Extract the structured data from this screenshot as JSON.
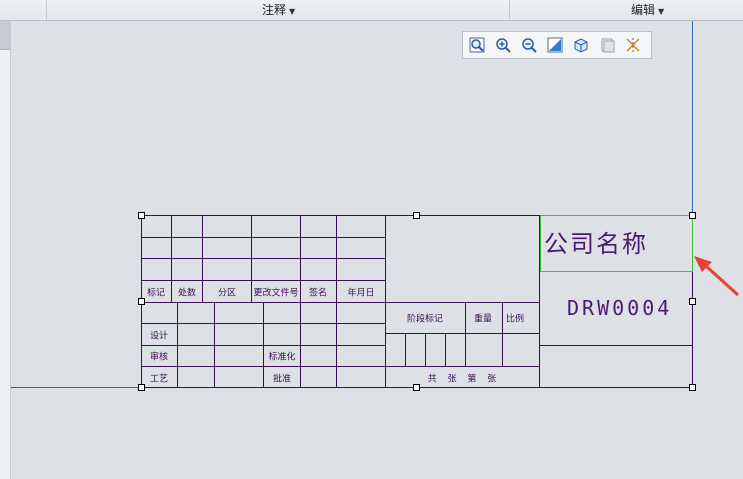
{
  "ribbon": {
    "annotate_label": "注释",
    "edit_label": "编辑"
  },
  "toolbar": {
    "icons": [
      "zoom-window-icon",
      "zoom-in-icon",
      "zoom-out-icon",
      "repaint-icon",
      "view-cube-icon",
      "saved-views-icon",
      "display-style-icon"
    ]
  },
  "title_block": {
    "company_name": "公司名称",
    "drawing_number": "DRW0004",
    "rev_header": [
      "标记",
      "处数",
      "分区",
      "更改文件号",
      "签名",
      "年月日"
    ],
    "row_design": "设计",
    "row_check": "审核",
    "row_process": "工艺",
    "standardize": "标准化",
    "approve": "批准",
    "stage_mark": "阶段标记",
    "weight": "重量",
    "scale": "比例",
    "sheet_info": "共 张 第 张"
  },
  "colors": {
    "table_line": "#3a0f54",
    "selection": "#3bbf3b",
    "border_line": "#2f62b0",
    "arrow": "#e8403a"
  }
}
